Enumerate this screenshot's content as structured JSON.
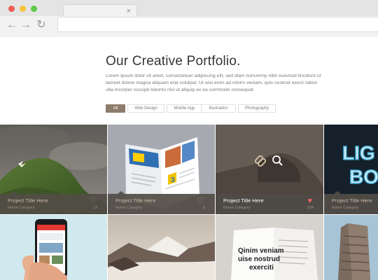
{
  "browser": {
    "close_icon": "×",
    "back_icon": "←",
    "forward_icon": "→",
    "reload_icon": "↻"
  },
  "hero": {
    "title": "Our Creative Portfolio.",
    "intro": "Lorem ipsum dolor sit amet, consectetuer adipiscing elit, sed diam nonummy nibh euismod tincidunt ut laoreet dolore magna aliquam erat volutpat. Ut wisi enim ad minim veniam, quis nostrud exerci tation ulla-mcorper suscipit lobortis nisl ut aliquip ex ea commodo consequat."
  },
  "filters": [
    {
      "label": "All",
      "active": true
    },
    {
      "label": "Web Design",
      "active": false
    },
    {
      "label": "Mobile App",
      "active": false
    },
    {
      "label": "Illustration",
      "active": false
    },
    {
      "label": "Photography",
      "active": false
    }
  ],
  "projects": [
    {
      "title": "Project Title Here",
      "category": "Name Category",
      "likes": "13",
      "highlighted": false
    },
    {
      "title": "Project Title Here",
      "category": "Name Category",
      "likes": "8",
      "highlighted": false
    },
    {
      "title": "Project Title Here",
      "category": "Name Category",
      "likes": "254",
      "highlighted": true
    },
    {
      "title": "Project Title Here",
      "category": "Name Category",
      "likes": "",
      "highlighted": false
    }
  ],
  "tile_texts": {
    "lights_line1": "LIG",
    "lights_line2": "BO",
    "book_line1": "Qinim veniam",
    "book_line2": "uise nostrud",
    "book_line3": "exerciti",
    "brochure_number": "3"
  },
  "colors": {
    "accent": "#8d7c6c",
    "heart_active": "#f1626f"
  }
}
